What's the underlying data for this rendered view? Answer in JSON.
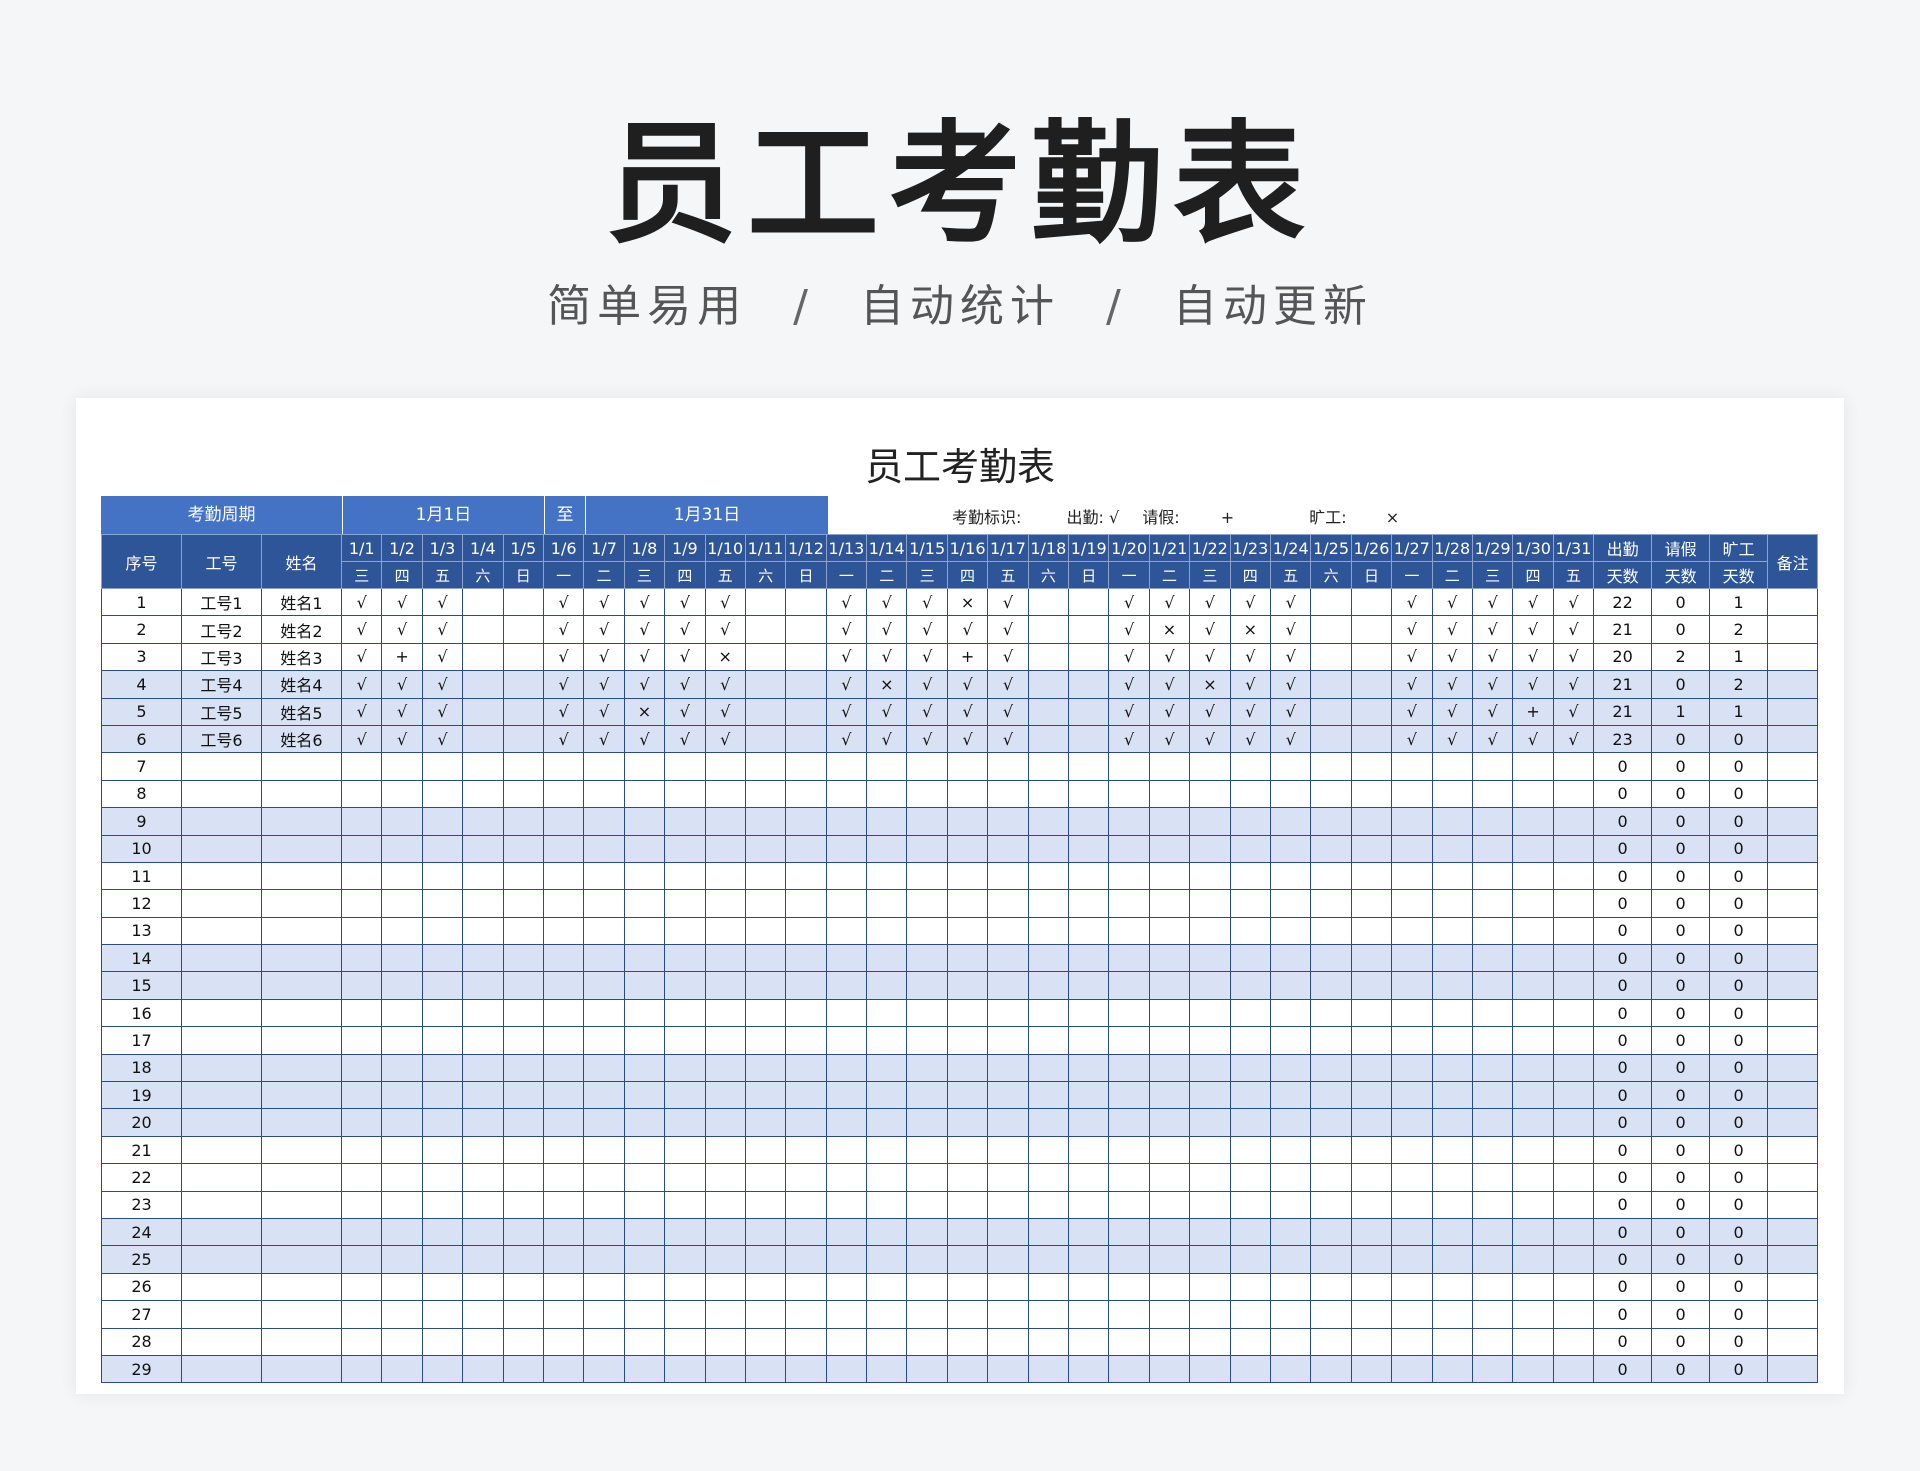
{
  "hero": {
    "title": "员工考勤表",
    "tag1": "简单易用",
    "tag2": "自动统计",
    "tag3": "自动更新",
    "sep": "/"
  },
  "sheet": {
    "title": "员工考勤表",
    "period_label": "考勤周期",
    "period_start": "1月1日",
    "period_to": "至",
    "period_end": "1月31日",
    "legend_label": "考勤标识:",
    "legend_present": "出勤: √",
    "legend_leave": "请假:",
    "legend_leave_sym": "+",
    "legend_absent": "旷工:",
    "legend_absent_sym": "×"
  },
  "columns": {
    "seq": "序号",
    "id": "工号",
    "name": "姓名",
    "present_top": "出勤",
    "present_bottom": "天数",
    "leave_top": "请假",
    "leave_bottom": "天数",
    "absent_top": "旷工",
    "absent_bottom": "天数",
    "remark": "备注"
  },
  "dates": [
    "1/1",
    "1/2",
    "1/3",
    "1/4",
    "1/5",
    "1/6",
    "1/7",
    "1/8",
    "1/9",
    "1/10",
    "1/11",
    "1/12",
    "1/13",
    "1/14",
    "1/15",
    "1/16",
    "1/17",
    "1/18",
    "1/19",
    "1/20",
    "1/21",
    "1/22",
    "1/23",
    "1/24",
    "1/25",
    "1/26",
    "1/27",
    "1/28",
    "1/29",
    "1/30",
    "1/31"
  ],
  "weekdays": [
    "三",
    "四",
    "五",
    "六",
    "日",
    "一",
    "二",
    "三",
    "四",
    "五",
    "六",
    "日",
    "一",
    "二",
    "三",
    "四",
    "五",
    "六",
    "日",
    "一",
    "二",
    "三",
    "四",
    "五",
    "六",
    "日",
    "一",
    "二",
    "三",
    "四",
    "五"
  ],
  "rows": [
    {
      "seq": "1",
      "id": "工号1",
      "name": "姓名1",
      "marks": [
        "√",
        "√",
        "√",
        "",
        "",
        "√",
        "√",
        "√",
        "√",
        "√",
        "",
        "",
        "√",
        "√",
        "√",
        "×",
        "√",
        "",
        "",
        "√",
        "√",
        "√",
        "√",
        "√",
        "",
        "",
        "√",
        "√",
        "√",
        "√",
        "√"
      ],
      "present": "22",
      "leave": "0",
      "absent": "1"
    },
    {
      "seq": "2",
      "id": "工号2",
      "name": "姓名2",
      "marks": [
        "√",
        "√",
        "√",
        "",
        "",
        "√",
        "√",
        "√",
        "√",
        "√",
        "",
        "",
        "√",
        "√",
        "√",
        "√",
        "√",
        "",
        "",
        "√",
        "×",
        "√",
        "×",
        "√",
        "",
        "",
        "√",
        "√",
        "√",
        "√",
        "√"
      ],
      "present": "21",
      "leave": "0",
      "absent": "2"
    },
    {
      "seq": "3",
      "id": "工号3",
      "name": "姓名3",
      "marks": [
        "√",
        "+",
        "√",
        "",
        "",
        "√",
        "√",
        "√",
        "√",
        "×",
        "",
        "",
        "√",
        "√",
        "√",
        "+",
        "√",
        "",
        "",
        "√",
        "√",
        "√",
        "√",
        "√",
        "",
        "",
        "√",
        "√",
        "√",
        "√",
        "√"
      ],
      "present": "20",
      "leave": "2",
      "absent": "1"
    },
    {
      "seq": "4",
      "id": "工号4",
      "name": "姓名4",
      "marks": [
        "√",
        "√",
        "√",
        "",
        "",
        "√",
        "√",
        "√",
        "√",
        "√",
        "",
        "",
        "√",
        "×",
        "√",
        "√",
        "√",
        "",
        "",
        "√",
        "√",
        "×",
        "√",
        "√",
        "",
        "",
        "√",
        "√",
        "√",
        "√",
        "√"
      ],
      "present": "21",
      "leave": "0",
      "absent": "2"
    },
    {
      "seq": "5",
      "id": "工号5",
      "name": "姓名5",
      "marks": [
        "√",
        "√",
        "√",
        "",
        "",
        "√",
        "√",
        "×",
        "√",
        "√",
        "",
        "",
        "√",
        "√",
        "√",
        "√",
        "√",
        "",
        "",
        "√",
        "√",
        "√",
        "√",
        "√",
        "",
        "",
        "√",
        "√",
        "√",
        "+",
        "√"
      ],
      "present": "21",
      "leave": "1",
      "absent": "1"
    },
    {
      "seq": "6",
      "id": "工号6",
      "name": "姓名6",
      "marks": [
        "√",
        "√",
        "√",
        "",
        "",
        "√",
        "√",
        "√",
        "√",
        "√",
        "",
        "",
        "√",
        "√",
        "√",
        "√",
        "√",
        "",
        "",
        "√",
        "√",
        "√",
        "√",
        "√",
        "",
        "",
        "√",
        "√",
        "√",
        "√",
        "√"
      ],
      "present": "23",
      "leave": "0",
      "absent": "0"
    },
    {
      "seq": "7",
      "id": "",
      "name": "",
      "marks": [],
      "present": "0",
      "leave": "0",
      "absent": "0"
    },
    {
      "seq": "8",
      "id": "",
      "name": "",
      "marks": [],
      "present": "0",
      "leave": "0",
      "absent": "0"
    },
    {
      "seq": "9",
      "id": "",
      "name": "",
      "marks": [],
      "present": "0",
      "leave": "0",
      "absent": "0"
    },
    {
      "seq": "10",
      "id": "",
      "name": "",
      "marks": [],
      "present": "0",
      "leave": "0",
      "absent": "0"
    },
    {
      "seq": "11",
      "id": "",
      "name": "",
      "marks": [],
      "present": "0",
      "leave": "0",
      "absent": "0"
    },
    {
      "seq": "12",
      "id": "",
      "name": "",
      "marks": [],
      "present": "0",
      "leave": "0",
      "absent": "0"
    },
    {
      "seq": "13",
      "id": "",
      "name": "",
      "marks": [],
      "present": "0",
      "leave": "0",
      "absent": "0"
    },
    {
      "seq": "14",
      "id": "",
      "name": "",
      "marks": [],
      "present": "0",
      "leave": "0",
      "absent": "0"
    },
    {
      "seq": "15",
      "id": "",
      "name": "",
      "marks": [],
      "present": "0",
      "leave": "0",
      "absent": "0"
    },
    {
      "seq": "16",
      "id": "",
      "name": "",
      "marks": [],
      "present": "0",
      "leave": "0",
      "absent": "0"
    },
    {
      "seq": "17",
      "id": "",
      "name": "",
      "marks": [],
      "present": "0",
      "leave": "0",
      "absent": "0"
    },
    {
      "seq": "18",
      "id": "",
      "name": "",
      "marks": [],
      "present": "0",
      "leave": "0",
      "absent": "0"
    },
    {
      "seq": "19",
      "id": "",
      "name": "",
      "marks": [],
      "present": "0",
      "leave": "0",
      "absent": "0"
    },
    {
      "seq": "20",
      "id": "",
      "name": "",
      "marks": [],
      "present": "0",
      "leave": "0",
      "absent": "0"
    },
    {
      "seq": "21",
      "id": "",
      "name": "",
      "marks": [],
      "present": "0",
      "leave": "0",
      "absent": "0"
    },
    {
      "seq": "22",
      "id": "",
      "name": "",
      "marks": [],
      "present": "0",
      "leave": "0",
      "absent": "0"
    },
    {
      "seq": "23",
      "id": "",
      "name": "",
      "marks": [],
      "present": "0",
      "leave": "0",
      "absent": "0"
    },
    {
      "seq": "24",
      "id": "",
      "name": "",
      "marks": [],
      "present": "0",
      "leave": "0",
      "absent": "0"
    },
    {
      "seq": "25",
      "id": "",
      "name": "",
      "marks": [],
      "present": "0",
      "leave": "0",
      "absent": "0"
    },
    {
      "seq": "26",
      "id": "",
      "name": "",
      "marks": [],
      "present": "0",
      "leave": "0",
      "absent": "0"
    },
    {
      "seq": "27",
      "id": "",
      "name": "",
      "marks": [],
      "present": "0",
      "leave": "0",
      "absent": "0"
    },
    {
      "seq": "28",
      "id": "",
      "name": "",
      "marks": [],
      "present": "0",
      "leave": "0",
      "absent": "0"
    },
    {
      "seq": "29",
      "id": "",
      "name": "",
      "marks": [],
      "present": "0",
      "leave": "0",
      "absent": "0"
    }
  ],
  "colors": {
    "header_bg": "#2e5597",
    "period_bg": "#4472c4",
    "row_shade": "#d9e1f5",
    "border": "#2b4a8b"
  }
}
